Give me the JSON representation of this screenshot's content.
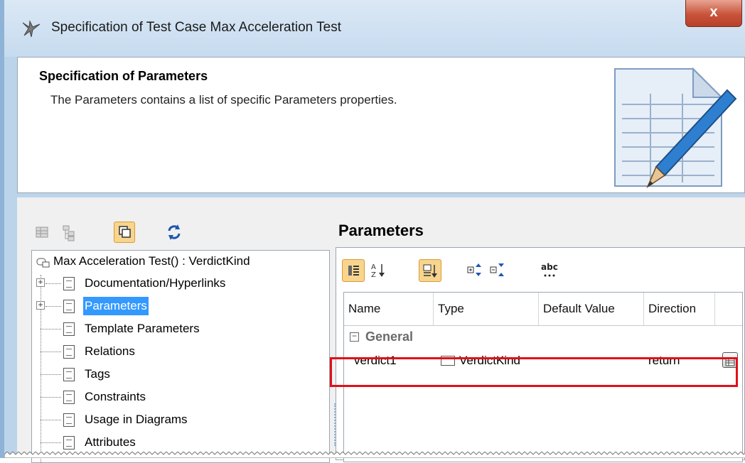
{
  "window": {
    "title": "Specification of Test Case Max Acceleration Test",
    "close_label": "x"
  },
  "header": {
    "title": "Specification of Parameters",
    "description": "The Parameters contains a list of specific Parameters properties."
  },
  "toolbar": {
    "icons": [
      "table-view-icon",
      "tree-view-icon",
      "compact-view-icon",
      "refresh-icon"
    ]
  },
  "tree": {
    "root_label": "Max Acceleration Test() : VerdictKind",
    "items": [
      {
        "label": "Documentation/Hyperlinks",
        "expandable": true
      },
      {
        "label": "Parameters",
        "expandable": true,
        "selected": true
      },
      {
        "label": "Template Parameters"
      },
      {
        "label": "Relations"
      },
      {
        "label": "Tags"
      },
      {
        "label": "Constraints"
      },
      {
        "label": "Usage in Diagrams"
      },
      {
        "label": "Attributes"
      }
    ]
  },
  "panel": {
    "title": "Parameters",
    "toolbar_icons": [
      "categorized-icon",
      "sort-alpha-icon",
      "sort-order-icon",
      "expand-all-icon",
      "collapse-all-icon",
      "abc-spell-icon"
    ],
    "columns": [
      "Name",
      "Type",
      "Default Value",
      "Direction"
    ],
    "group": "General",
    "rows": [
      {
        "name": "verdict1",
        "type": "VerdictKind",
        "default_value": "",
        "direction": "return"
      }
    ]
  }
}
